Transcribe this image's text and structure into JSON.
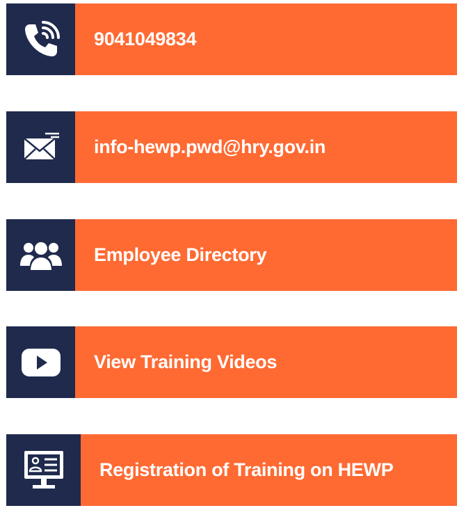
{
  "colors": {
    "icon_background": "#1f2a4d",
    "tile_background": "#ff6a33",
    "text": "#ffffff"
  },
  "tiles": [
    {
      "label": "9041049834",
      "icon": "phone-icon"
    },
    {
      "label": "info-hewp.pwd@hry.gov.in",
      "icon": "mail-icon"
    },
    {
      "label": "Employee Directory",
      "icon": "users-icon"
    },
    {
      "label": "View Training Videos",
      "icon": "youtube-icon"
    },
    {
      "label": "Registration of Training on HEWP",
      "icon": "registration-monitor-icon"
    }
  ]
}
